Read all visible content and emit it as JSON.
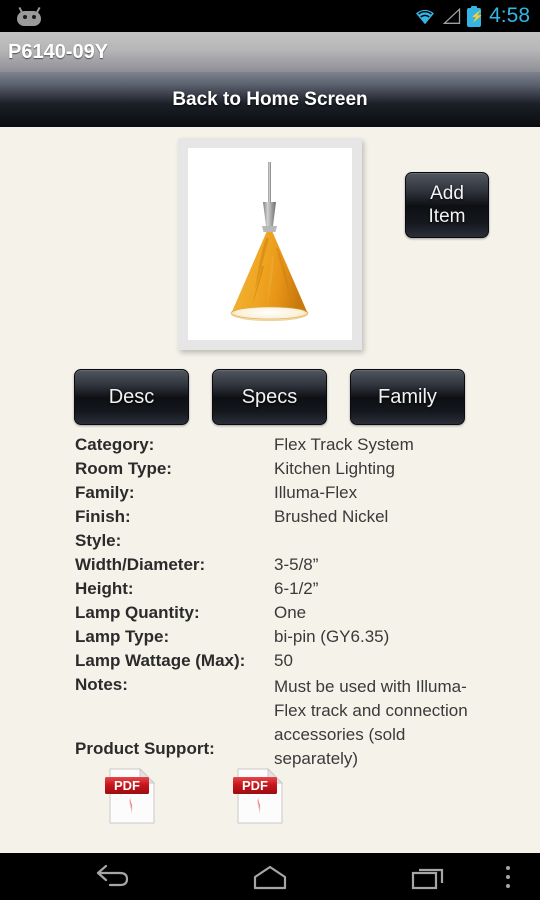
{
  "statusbar": {
    "android_icon": "android-head-icon",
    "wifi_icon": "wifi-icon",
    "signal_icon": "signal-bars-icon",
    "battery_icon": "battery-charging-icon",
    "time": "4:58",
    "accent_color": "#33B5E5"
  },
  "titlebar": {
    "title": "P6140-09Y"
  },
  "homebar": {
    "label": "Back to Home Screen"
  },
  "product": {
    "image_alt": "pendant-light-amber-cone",
    "add_button_line1": "Add",
    "add_button_line2": "Item"
  },
  "tabs": [
    {
      "label": "Desc"
    },
    {
      "label": "Specs"
    },
    {
      "label": "Family"
    }
  ],
  "specs": [
    {
      "label": "Category:",
      "value": "Flex Track System"
    },
    {
      "label": "Room Type:",
      "value": "Kitchen Lighting"
    },
    {
      "label": "Family:",
      "value": "Illuma-Flex"
    },
    {
      "label": "Finish:",
      "value": "Brushed Nickel"
    },
    {
      "label": "Style:",
      "value": ""
    },
    {
      "label": "Width/Diameter:",
      "value": "3-5/8”"
    },
    {
      "label": "Height:",
      "value": "6-1/2”"
    },
    {
      "label": "Lamp Quantity:",
      "value": "One"
    },
    {
      "label": "Lamp Type:",
      "value": "bi-pin (GY6.35)"
    },
    {
      "label": "Lamp Wattage (Max):",
      "value": "50"
    }
  ],
  "notes": {
    "label": "Notes:",
    "value": "Must be used with Illuma-Flex track and connection accessories (sold separately)"
  },
  "product_support": {
    "label": "Product Support:",
    "documents": [
      {
        "type": "PDF",
        "name": "pdf-document-1"
      },
      {
        "type": "PDF",
        "name": "pdf-document-2"
      }
    ]
  },
  "navbar": {
    "back": "back-icon",
    "home": "home-icon",
    "recents": "recents-icon",
    "menu": "overflow-menu-icon"
  },
  "colors": {
    "page_bg": "#F5F2EA",
    "accent": "#33B5E5",
    "pdf_red": "#C8161D",
    "lamp_amber": "#E8A628"
  }
}
